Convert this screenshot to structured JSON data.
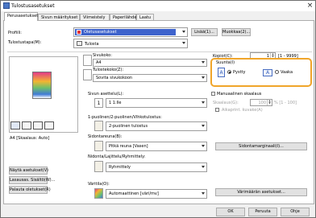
{
  "window": {
    "title": "Tulostusasetukset",
    "close_glyph": "×"
  },
  "tabs": [
    {
      "label": "Perusasetukset"
    },
    {
      "label": "Sivun määritykset"
    },
    {
      "label": "Viimeistely"
    },
    {
      "label": "Paperilähde"
    },
    {
      "label": "Laatu"
    }
  ],
  "profile": {
    "label": "Profiili:",
    "value": "Oletusasetukset",
    "add_button": "Lisää(1)...",
    "edit_button": "Muokkaa(2)..."
  },
  "output_method": {
    "label": "Tulostustapa(M):",
    "value": "Tulosta"
  },
  "page_size": {
    "label": "Sivukoko:",
    "value": "A4"
  },
  "output_size": {
    "label": "Tulostekoko(Z):",
    "value": "Sovita sivukokoon"
  },
  "copies": {
    "label": "Kopiot(C):",
    "value": "1",
    "range": "[1 - 9999]"
  },
  "orientation": {
    "label": "Suunta(I)",
    "portrait_label": "Pystty",
    "landscape_label": "Vaaka",
    "selected": "portrait"
  },
  "pages_per_sheet": {
    "label": "Sivun asettelu(L):",
    "value": "1 1:lle"
  },
  "manual_scaling": {
    "checkbox_label": "Manuaalinen skaalaus",
    "scale_label": "Skaalaus(G):",
    "scale_value": "100",
    "scale_range": "% [1 - 100]",
    "watermark_label": "Aikaprint. kuvake(A)"
  },
  "duplex": {
    "label": "1-puolinen/2-puolinen/Vihkotulostus:",
    "value": "2-puolinen tulostus"
  },
  "binding": {
    "label": "Sidontareuna(B):",
    "value": "Pitkä reuna [Vasen]",
    "settings_button": "Sidontamarginaali(I)..."
  },
  "finishing": {
    "label": "Nidonta/Lajittelu/Ryhmittely:",
    "value": "Ryhmittely"
  },
  "color_mode": {
    "label": "Väritila(O):",
    "value": "Automaattinen [väri/mv]",
    "settings_button": "Värimäärän asetukset..."
  },
  "preview": {
    "caption": "A4 [Skaalaus: Auto]"
  },
  "left_buttons": [
    {
      "label": "Näytä asetukset(V)"
    },
    {
      "label": "Lasausas. Sisältö(W)..."
    },
    {
      "label": "Palauta oletukset(R)"
    }
  ],
  "footer": {
    "ok": "OK",
    "cancel": "Peruuta",
    "help": "Ohje"
  },
  "colors": {
    "accent_highlight": "#f0a52a",
    "selected_profile_bg": "#3e63cc"
  }
}
